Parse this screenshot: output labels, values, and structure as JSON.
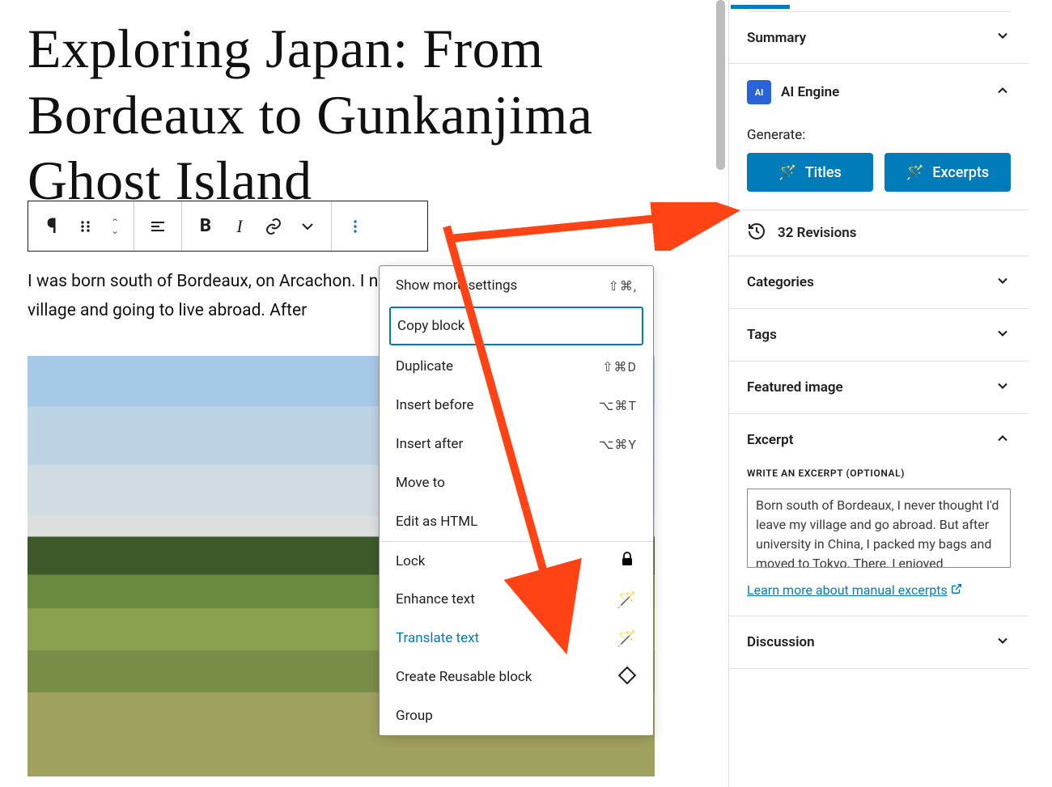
{
  "post": {
    "title": "Exploring Japan: From Bordeaux to Gunkanjima Ghost Island",
    "body_snippet": "I was born south of Bordeaux, on Arcachon. I never thought of leaving my little village and going to live abroad. After"
  },
  "toolbar": {
    "paragraph_icon": "¶"
  },
  "context_menu": {
    "items": [
      {
        "label": "Show more settings",
        "shortcut": "⇧⌘,",
        "style": "normal"
      },
      {
        "label": "Copy block",
        "shortcut": "",
        "style": "highlight"
      },
      {
        "label": "Duplicate",
        "shortcut": "⇧⌘D",
        "style": "normal"
      },
      {
        "label": "Insert before",
        "shortcut": "⌥⌘T",
        "style": "normal"
      },
      {
        "label": "Insert after",
        "shortcut": "⌥⌘Y",
        "style": "normal"
      },
      {
        "label": "Move to",
        "shortcut": "",
        "style": "normal"
      },
      {
        "label": "Edit as HTML",
        "shortcut": "",
        "style": "normal"
      },
      {
        "label": "Lock",
        "shortcut": "",
        "style": "normal",
        "icon": "lock",
        "sep": true
      },
      {
        "label": "Enhance text",
        "shortcut": "",
        "style": "normal",
        "icon": "wand"
      },
      {
        "label": "Translate text",
        "shortcut": "",
        "style": "bluetext",
        "icon": "wand"
      },
      {
        "label": "Create Reusable block",
        "shortcut": "",
        "style": "normal",
        "icon": "reusable"
      },
      {
        "label": "Group",
        "shortcut": "",
        "style": "normal"
      }
    ]
  },
  "sidebar": {
    "summary": "Summary",
    "ai_engine": {
      "title": "AI Engine",
      "generate_label": "Generate:",
      "titles_btn": "Titles",
      "excerpts_btn": "Excerpts"
    },
    "revisions": "32 Revisions",
    "categories": "Categories",
    "tags": "Tags",
    "featured_image": "Featured image",
    "excerpt": {
      "title": "Excerpt",
      "caption": "WRITE AN EXCERPT (OPTIONAL)",
      "value": "Born south of Bordeaux, I never thought I'd leave my village and go abroad. But after university in China, I packed my bags and moved to Tokyo. There, I enjoyed",
      "link": "Learn more about manual excerpts"
    },
    "discussion": "Discussion"
  }
}
